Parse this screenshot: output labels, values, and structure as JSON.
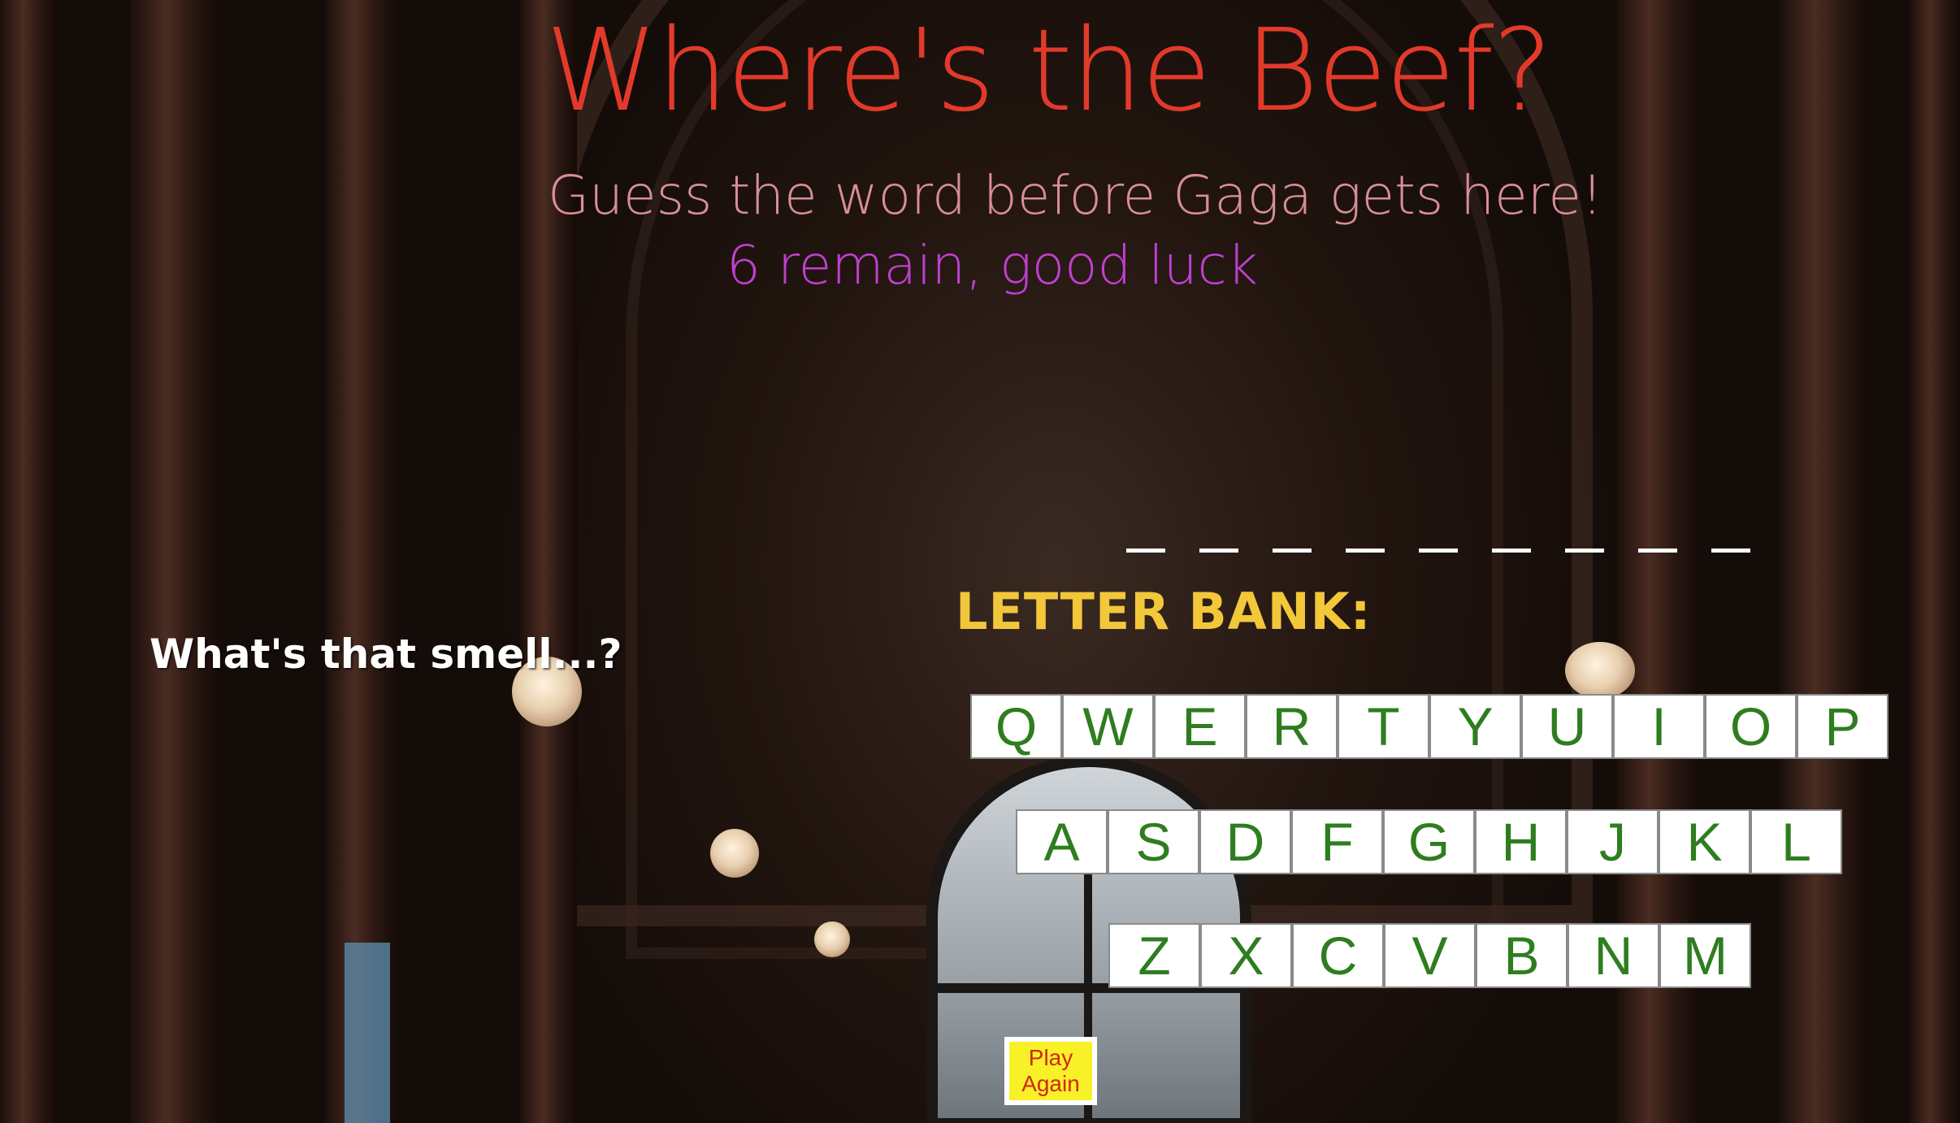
{
  "header": {
    "title": "Where's the Beef?",
    "subtitle": "Guess the word before Gaga gets here!",
    "remaining": "6 remain, good luck"
  },
  "word": {
    "blanks": [
      "_",
      "_",
      "_",
      "_",
      "_",
      "_",
      "_",
      "_",
      "_"
    ]
  },
  "hint": {
    "text": "What's that smell...?"
  },
  "letter_bank": {
    "label": "LETTER BANK:",
    "rows": [
      [
        "Q",
        "W",
        "E",
        "R",
        "T",
        "Y",
        "U",
        "I",
        "O",
        "P"
      ],
      [
        "A",
        "S",
        "D",
        "F",
        "G",
        "H",
        "J",
        "K",
        "L"
      ],
      [
        "Z",
        "X",
        "C",
        "V",
        "B",
        "N",
        "M"
      ]
    ]
  },
  "controls": {
    "play_again_label": "Play Again"
  },
  "colors": {
    "title": "#e23a2a",
    "subtitle": "#d88e98",
    "remaining": "#c03fd0",
    "bank_label": "#f2c73a",
    "key_text": "#2e7d1f",
    "play_bg": "#f8f128",
    "play_text": "#d0281a"
  }
}
